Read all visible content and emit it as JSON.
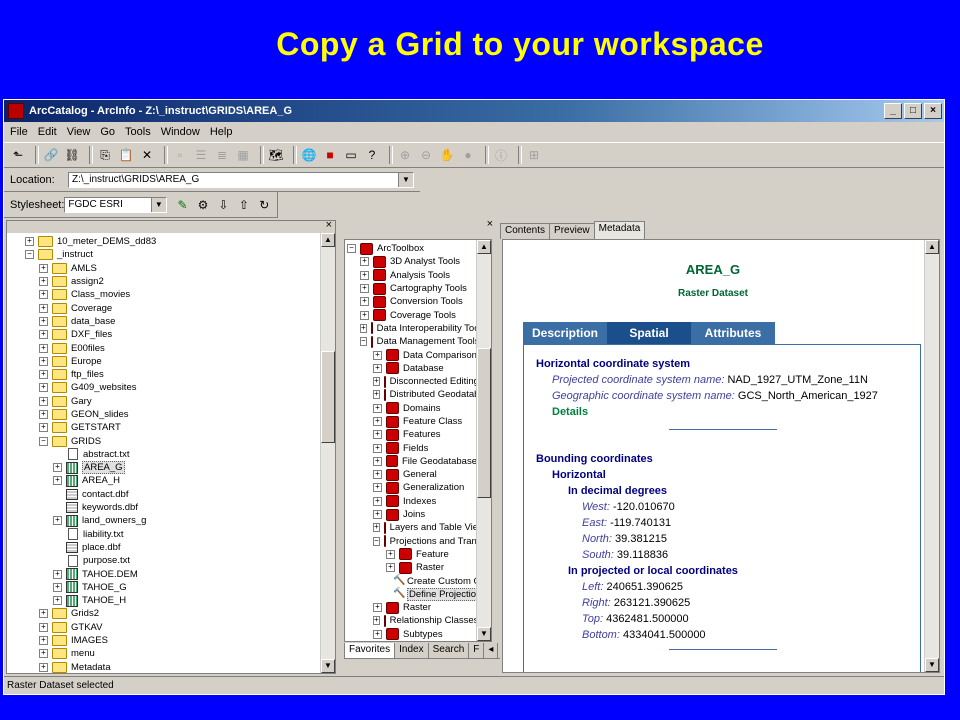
{
  "slide": {
    "title": "Copy a Grid to your workspace"
  },
  "window": {
    "title": "ArcCatalog - ArcInfo - Z:\\_instruct\\GRIDS\\AREA_G",
    "min": "_",
    "max": "□",
    "close": "×"
  },
  "menu": [
    "File",
    "Edit",
    "View",
    "Go",
    "Tools",
    "Window",
    "Help"
  ],
  "toolbar": {
    "location_label": "Location:",
    "location_value": "Z:\\_instruct\\GRIDS\\AREA_G",
    "stylesheet_label": "Stylesheet:",
    "stylesheet_value": "FGDC ESRI"
  },
  "tree": [
    {
      "label": "10_meter_DEMS_dd83",
      "exp": "+",
      "indent": 1,
      "icon": "folder"
    },
    {
      "label": "_instruct",
      "exp": "−",
      "indent": 1,
      "icon": "folder"
    },
    {
      "label": "AMLS",
      "exp": "+",
      "indent": 2,
      "icon": "folder"
    },
    {
      "label": "assign2",
      "exp": "+",
      "indent": 2,
      "icon": "folder"
    },
    {
      "label": "Class_movies",
      "exp": "+",
      "indent": 2,
      "icon": "folder"
    },
    {
      "label": "Coverage",
      "exp": "+",
      "indent": 2,
      "icon": "folder"
    },
    {
      "label": "data_base",
      "exp": "+",
      "indent": 2,
      "icon": "folder"
    },
    {
      "label": "DXF_files",
      "exp": "+",
      "indent": 2,
      "icon": "folder"
    },
    {
      "label": "E00files",
      "exp": "+",
      "indent": 2,
      "icon": "folder"
    },
    {
      "label": "Europe",
      "exp": "+",
      "indent": 2,
      "icon": "folder"
    },
    {
      "label": "ftp_files",
      "exp": "+",
      "indent": 2,
      "icon": "folder"
    },
    {
      "label": "G409_websites",
      "exp": "+",
      "indent": 2,
      "icon": "folder"
    },
    {
      "label": "Gary",
      "exp": "+",
      "indent": 2,
      "icon": "folder"
    },
    {
      "label": "GEON_slides",
      "exp": "+",
      "indent": 2,
      "icon": "folder"
    },
    {
      "label": "GETSTART",
      "exp": "+",
      "indent": 2,
      "icon": "folder"
    },
    {
      "label": "GRIDS",
      "exp": "−",
      "indent": 2,
      "icon": "folder"
    },
    {
      "label": "abstract.txt",
      "exp": "",
      "indent": 3,
      "icon": "file"
    },
    {
      "label": "AREA_G",
      "exp": "+",
      "indent": 3,
      "icon": "grid",
      "selected": true
    },
    {
      "label": "AREA_H",
      "exp": "+",
      "indent": 3,
      "icon": "grid"
    },
    {
      "label": "contact.dbf",
      "exp": "",
      "indent": 3,
      "icon": "table"
    },
    {
      "label": "keywords.dbf",
      "exp": "",
      "indent": 3,
      "icon": "table"
    },
    {
      "label": "land_owners_g",
      "exp": "+",
      "indent": 3,
      "icon": "grid"
    },
    {
      "label": "liability.txt",
      "exp": "",
      "indent": 3,
      "icon": "file"
    },
    {
      "label": "place.dbf",
      "exp": "",
      "indent": 3,
      "icon": "table"
    },
    {
      "label": "purpose.txt",
      "exp": "",
      "indent": 3,
      "icon": "file"
    },
    {
      "label": "TAHOE.DEM",
      "exp": "+",
      "indent": 3,
      "icon": "grid"
    },
    {
      "label": "TAHOE_G",
      "exp": "+",
      "indent": 3,
      "icon": "grid"
    },
    {
      "label": "TAHOE_H",
      "exp": "+",
      "indent": 3,
      "icon": "grid"
    },
    {
      "label": "Grids2",
      "exp": "+",
      "indent": 2,
      "icon": "folder"
    },
    {
      "label": "GTKAV",
      "exp": "+",
      "indent": 2,
      "icon": "folder"
    },
    {
      "label": "IMAGES",
      "exp": "+",
      "indent": 2,
      "icon": "folder"
    },
    {
      "label": "menu",
      "exp": "+",
      "indent": 2,
      "icon": "folder"
    },
    {
      "label": "Metadata",
      "exp": "+",
      "indent": 2,
      "icon": "folder"
    }
  ],
  "toolbox": [
    {
      "label": "ArcToolbox",
      "exp": "−",
      "indent": 0,
      "icon": "box"
    },
    {
      "label": "3D Analyst Tools",
      "exp": "+",
      "indent": 1,
      "icon": "box"
    },
    {
      "label": "Analysis Tools",
      "exp": "+",
      "indent": 1,
      "icon": "box"
    },
    {
      "label": "Cartography Tools",
      "exp": "+",
      "indent": 1,
      "icon": "box"
    },
    {
      "label": "Conversion Tools",
      "exp": "+",
      "indent": 1,
      "icon": "box"
    },
    {
      "label": "Coverage Tools",
      "exp": "+",
      "indent": 1,
      "icon": "box"
    },
    {
      "label": "Data Interoperability Too",
      "exp": "+",
      "indent": 1,
      "icon": "box"
    },
    {
      "label": "Data Management Tools",
      "exp": "−",
      "indent": 1,
      "icon": "box"
    },
    {
      "label": "Data Comparison",
      "exp": "+",
      "indent": 2,
      "icon": "box"
    },
    {
      "label": "Database",
      "exp": "+",
      "indent": 2,
      "icon": "box"
    },
    {
      "label": "Disconnected Editing",
      "exp": "+",
      "indent": 2,
      "icon": "box"
    },
    {
      "label": "Distributed Geodatab",
      "exp": "+",
      "indent": 2,
      "icon": "box"
    },
    {
      "label": "Domains",
      "exp": "+",
      "indent": 2,
      "icon": "box"
    },
    {
      "label": "Feature Class",
      "exp": "+",
      "indent": 2,
      "icon": "box"
    },
    {
      "label": "Features",
      "exp": "+",
      "indent": 2,
      "icon": "box"
    },
    {
      "label": "Fields",
      "exp": "+",
      "indent": 2,
      "icon": "box"
    },
    {
      "label": "File Geodatabase",
      "exp": "+",
      "indent": 2,
      "icon": "box"
    },
    {
      "label": "General",
      "exp": "+",
      "indent": 2,
      "icon": "box"
    },
    {
      "label": "Generalization",
      "exp": "+",
      "indent": 2,
      "icon": "box"
    },
    {
      "label": "Indexes",
      "exp": "+",
      "indent": 2,
      "icon": "box"
    },
    {
      "label": "Joins",
      "exp": "+",
      "indent": 2,
      "icon": "box"
    },
    {
      "label": "Layers and Table View",
      "exp": "+",
      "indent": 2,
      "icon": "box"
    },
    {
      "label": "Projections and Trans",
      "exp": "−",
      "indent": 2,
      "icon": "box"
    },
    {
      "label": "Feature",
      "exp": "+",
      "indent": 3,
      "icon": "box"
    },
    {
      "label": "Raster",
      "exp": "+",
      "indent": 3,
      "icon": "box"
    },
    {
      "label": "Create Custom Ge",
      "exp": "",
      "indent": 3,
      "icon": "tool"
    },
    {
      "label": "Define Projection",
      "exp": "",
      "indent": 3,
      "icon": "tool",
      "selected": true
    },
    {
      "label": "Raster",
      "exp": "+",
      "indent": 2,
      "icon": "box"
    },
    {
      "label": "Relationship Classes",
      "exp": "+",
      "indent": 2,
      "icon": "box"
    },
    {
      "label": "Subtypes",
      "exp": "+",
      "indent": 2,
      "icon": "box"
    }
  ],
  "toolbox_tabs": [
    "Favorites",
    "Index",
    "Search",
    "F"
  ],
  "meta_tabs": [
    "Contents",
    "Preview",
    "Metadata"
  ],
  "metadata": {
    "title": "AREA_G",
    "subtitle": "Raster Dataset",
    "tabs": [
      "Description",
      "Spatial",
      "Attributes"
    ],
    "hcs_heading": "Horizontal coordinate system",
    "proj_label": "Projected coordinate system name:",
    "proj_value": "NAD_1927_UTM_Zone_11N",
    "geo_label": "Geographic coordinate system name:",
    "geo_value": "GCS_North_American_1927",
    "details": "Details",
    "bc_heading": "Bounding coordinates",
    "horizontal": "Horizontal",
    "decimal_heading": "In decimal degrees",
    "west_label": "West:",
    "west_value": "-120.010670",
    "east_label": "East:",
    "east_value": "-119.740131",
    "north_label": "North:",
    "north_value": "39.381215",
    "south_label": "South:",
    "south_value": "39.118836",
    "projected_heading": "In projected or local coordinates",
    "left_label": "Left:",
    "left_value": "240651.390625",
    "right_label": "Right:",
    "right_value": "263121.390625",
    "top_label": "Top:",
    "top_value": "4362481.500000",
    "bottom_label": "Bottom:",
    "bottom_value": "4334041.500000"
  },
  "status": "Raster Dataset selected"
}
